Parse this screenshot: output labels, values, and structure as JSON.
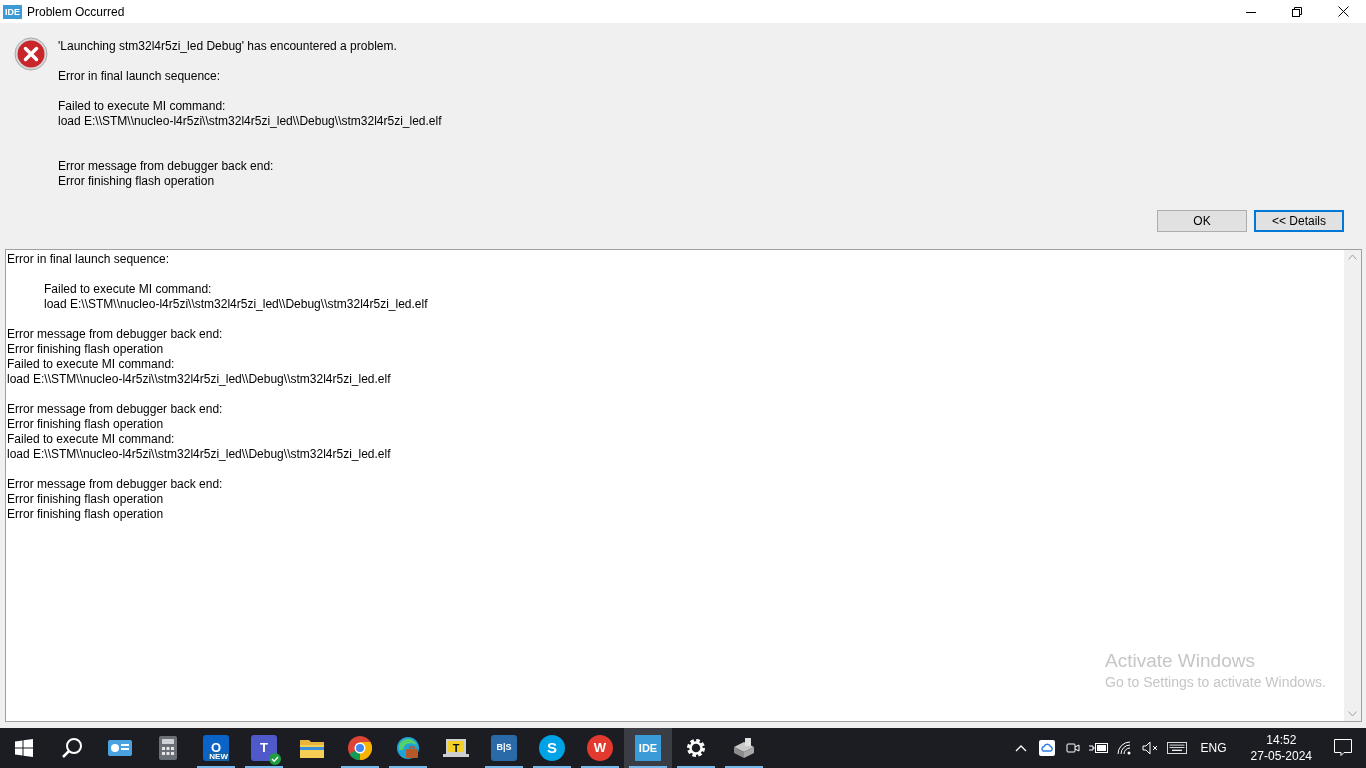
{
  "window": {
    "app_badge": "IDE",
    "title": "Problem Occurred",
    "controls": [
      {
        "kind": "minimize"
      },
      {
        "kind": "restore"
      },
      {
        "kind": "close"
      }
    ]
  },
  "message": {
    "headline": "'Launching stm32l4r5zi_led Debug' has encountered a problem.",
    "groups": [
      [
        "Error in final launch sequence:"
      ],
      [
        "Failed to execute MI command:",
        "load E:\\\\STM\\\\nucleo-l4r5zi\\\\stm32l4r5zi_led\\\\Debug\\\\stm32l4r5zi_led.elf"
      ],
      [
        "Error message from debugger back end:",
        "Error finishing flash operation"
      ]
    ]
  },
  "buttons": [
    {
      "label": "OK",
      "focused": false
    },
    {
      "label": "<< Details",
      "focused": true
    }
  ],
  "details": [
    {
      "indented": false,
      "lines": [
        "Error in final launch sequence:"
      ]
    },
    {
      "indented": true,
      "lines": [
        "Failed to execute MI command:",
        "load E:\\\\STM\\\\nucleo-l4r5zi\\\\stm32l4r5zi_led\\\\Debug\\\\stm32l4r5zi_led.elf"
      ]
    },
    {
      "indented": false,
      "lines": [
        "Error message from debugger back end:",
        "Error finishing flash operation",
        "Failed to execute MI command:",
        "load E:\\\\STM\\\\nucleo-l4r5zi\\\\stm32l4r5zi_led\\\\Debug\\\\stm32l4r5zi_led.elf"
      ]
    },
    {
      "indented": false,
      "lines": [
        "Error message from debugger back end:",
        "Error finishing flash operation",
        "Failed to execute MI command:",
        "load E:\\\\STM\\\\nucleo-l4r5zi\\\\stm32l4r5zi_led\\\\Debug\\\\stm32l4r5zi_led.elf"
      ]
    },
    {
      "indented": false,
      "lines": [
        "Error message from debugger back end:",
        "Error finishing flash operation",
        "Error finishing flash operation"
      ]
    }
  ],
  "activation_notice": {
    "title": "Activate Windows",
    "subtitle": "Go to Settings to activate Windows."
  },
  "taskbar": {
    "apps": [
      {
        "kind": "start",
        "running": false,
        "active": false
      },
      {
        "kind": "search",
        "running": false,
        "active": false
      },
      {
        "kind": "widgets",
        "running": false,
        "active": false
      },
      {
        "kind": "calculator",
        "running": false,
        "active": false
      },
      {
        "kind": "outlook",
        "glyph": "O",
        "sub": "NEW",
        "running": true,
        "active": false
      },
      {
        "kind": "teams",
        "glyph": "T",
        "running": true,
        "active": false
      },
      {
        "kind": "folder",
        "running": false,
        "active": false
      },
      {
        "kind": "chrome",
        "running": true,
        "active": false
      },
      {
        "kind": "edge",
        "running": true,
        "active": false
      },
      {
        "kind": "laptop",
        "glyph": "T",
        "running": false,
        "active": false
      },
      {
        "kind": "tile",
        "glyph": "B|S",
        "running": true,
        "active": false
      },
      {
        "kind": "skype",
        "glyph": "S",
        "running": true,
        "active": false
      },
      {
        "kind": "wps",
        "glyph": "W",
        "running": true,
        "active": false
      },
      {
        "kind": "ide",
        "glyph": "IDE",
        "running": true,
        "active": true
      },
      {
        "kind": "gear",
        "running": true,
        "active": false
      },
      {
        "kind": "device",
        "running": true,
        "active": false
      }
    ],
    "tray": [
      {
        "kind": "chevron"
      },
      {
        "kind": "cloud"
      },
      {
        "kind": "camera"
      },
      {
        "kind": "battery"
      },
      {
        "kind": "wifi"
      },
      {
        "kind": "mute"
      },
      {
        "kind": "keyboard"
      }
    ],
    "language": "ENG",
    "time": "14:52",
    "date": "27-05-2024"
  }
}
